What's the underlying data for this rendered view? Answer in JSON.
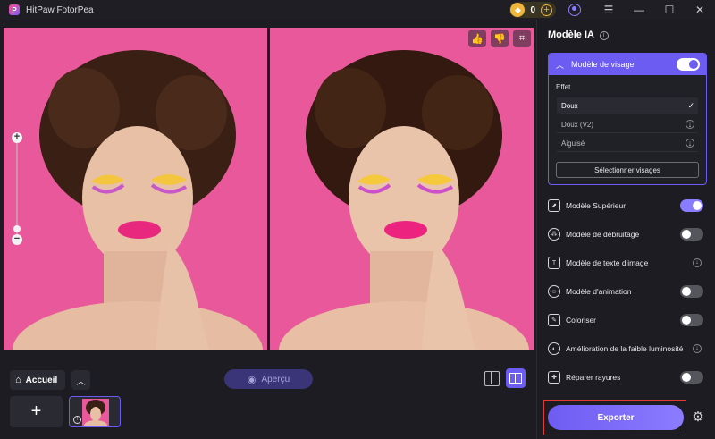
{
  "app": {
    "title": "HitPaw FotorPea",
    "coins": "0"
  },
  "window_controls": {
    "menu": "☰",
    "minimize": "—",
    "maximize": "☐",
    "close": "✕"
  },
  "canvas": {
    "thumb_up": "👍",
    "thumb_down": "👎",
    "crop": "⌗",
    "zoom_in": "+",
    "zoom_out": "−"
  },
  "bottom": {
    "home_label": "Accueil",
    "preview_label": "Aperçu",
    "add": "+"
  },
  "panel": {
    "title": "Modèle IA",
    "face_model": {
      "label": "Modèle de visage",
      "enabled": true,
      "effect_title": "Effet",
      "effects": [
        {
          "label": "Doux",
          "state": "selected"
        },
        {
          "label": "Doux (V2)",
          "state": "download"
        },
        {
          "label": "Aiguisé",
          "state": "download"
        }
      ],
      "select_faces": "Sélectionner visages"
    },
    "models": [
      {
        "label": "Modèle Supérieur",
        "icon": "upscale-icon",
        "control": "toggle",
        "enabled": true
      },
      {
        "label": "Modèle de débruitage",
        "icon": "denoise-icon",
        "control": "toggle",
        "enabled": false
      },
      {
        "label": "Modèle de texte d'image",
        "icon": "text-image-icon",
        "control": "download"
      },
      {
        "label": "Modèle d'animation",
        "icon": "animation-icon",
        "control": "toggle",
        "enabled": false
      },
      {
        "label": "Coloriser",
        "icon": "colorize-icon",
        "control": "toggle",
        "enabled": false
      },
      {
        "label": "Amélioration de la faible luminosité",
        "icon": "low-light-icon",
        "control": "download"
      },
      {
        "label": "Réparer rayures",
        "icon": "scratch-repair-icon",
        "control": "toggle",
        "enabled": false
      }
    ],
    "export_label": "Exporter"
  },
  "colors": {
    "accent": "#6c5cf2",
    "photo_background": "#e8589a",
    "export_highlight": "#e53935"
  }
}
